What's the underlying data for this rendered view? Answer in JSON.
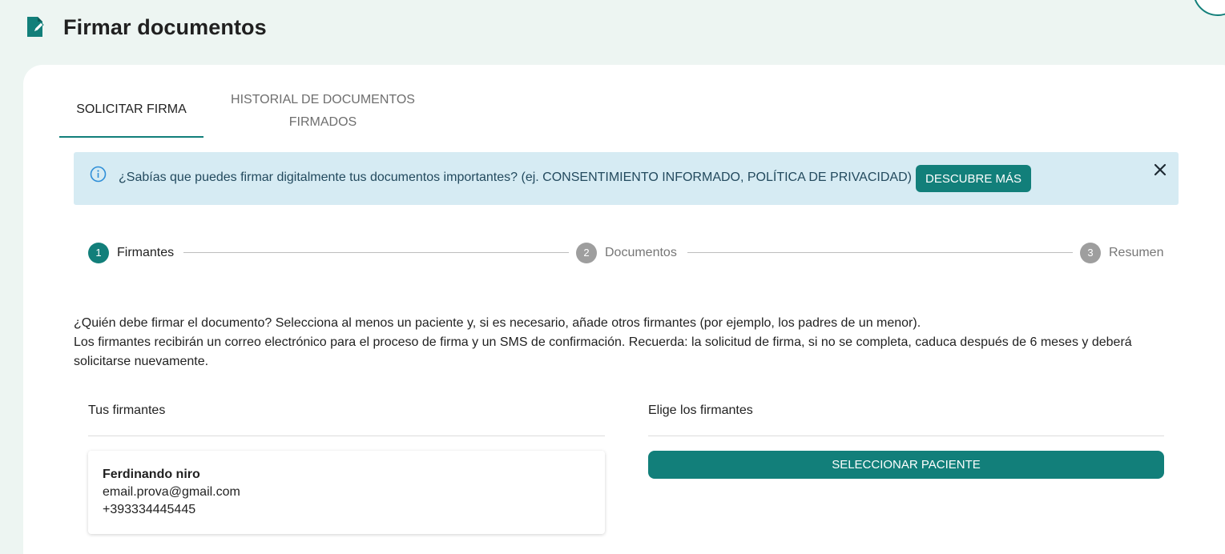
{
  "header": {
    "title": "Firmar documentos",
    "icon": "document-edit-icon"
  },
  "tabs": [
    {
      "label": "SOLICITAR FIRMA",
      "active": true
    },
    {
      "label_line1": "HISTORIAL DE DOCUMENTOS",
      "label_line2": "FIRMADOS",
      "active": false
    }
  ],
  "info_banner": {
    "text": "¿Sabías que puedes firmar digitalmente tus documentos importantes? (ej. CONSENTIMIENTO INFORMADO, POLÍTICA DE PRIVACIDAD)",
    "button_label": "DESCUBRE MÁS",
    "icon": "info-icon",
    "close_icon": "close-icon"
  },
  "stepper": [
    {
      "number": "1",
      "label": "Firmantes",
      "active": true
    },
    {
      "number": "2",
      "label": "Documentos",
      "active": false
    },
    {
      "number": "3",
      "label": "Resumen",
      "active": false
    }
  ],
  "description": {
    "line1": "¿Quién debe firmar el documento? Selecciona al menos un paciente y, si es necesario, añade otros firmantes (por ejemplo, los padres de un menor).",
    "line2": "Los firmantes recibirán un correo electrónico para el proceso de firma y un SMS de confirmación. Recuerda: la solicitud de firma, si no se completa, caduca después de 6 meses y deberá solicitarse nuevamente."
  },
  "signers_column": {
    "title": "Tus firmantes",
    "signers": [
      {
        "name": "Ferdinando niro",
        "email": "email.prova@gmail.com",
        "phone": "+393334445445"
      }
    ]
  },
  "choose_column": {
    "title": "Elige los firmantes",
    "button_label": "SELECCIONAR PACIENTE"
  },
  "colors": {
    "accent": "#127f7a",
    "background": "#edf5f2",
    "banner": "#d6ebf3",
    "step_inactive": "#9e9e9e"
  }
}
